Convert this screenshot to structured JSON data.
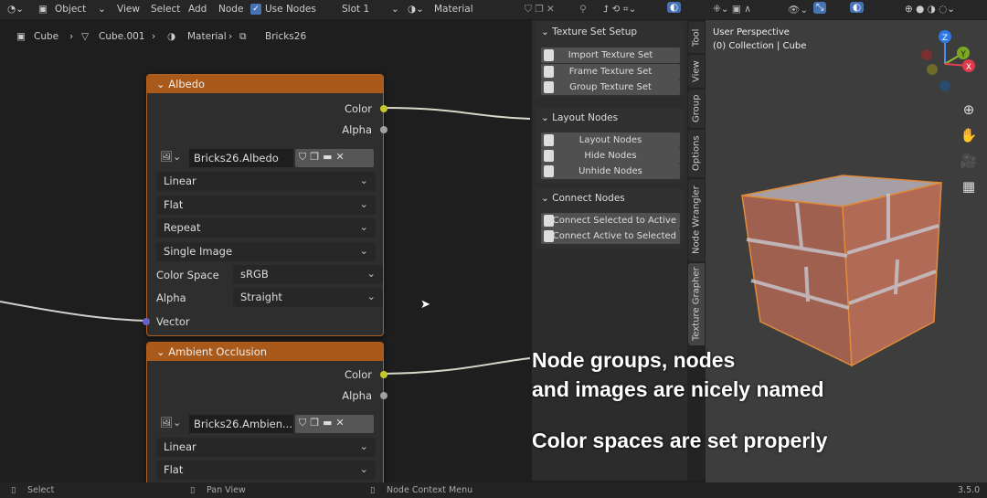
{
  "header": {
    "mode": "Object",
    "menus": [
      "View",
      "Select",
      "Add",
      "Node"
    ],
    "use_nodes_label": "Use Nodes",
    "use_nodes_checked": true,
    "slot": "Slot 1",
    "material": "Material",
    "accent": "#4772b3"
  },
  "breadcrumb": [
    "Cube",
    "Cube.001",
    "Material",
    "Bricks26"
  ],
  "nodes": [
    {
      "title": "Albedo",
      "outputs": [
        "Color",
        "Alpha"
      ],
      "image": "Bricks26.Albedo",
      "interpolation": "Linear",
      "projection": "Flat",
      "extension": "Repeat",
      "source": "Single Image",
      "color_space_label": "Color Space",
      "color_space": "sRGB",
      "alpha_label": "Alpha",
      "alpha": "Straight",
      "input": "Vector"
    },
    {
      "title": "Ambient Occlusion",
      "outputs": [
        "Color",
        "Alpha"
      ],
      "image": "Bricks26.Ambien...",
      "interpolation": "Linear",
      "projection": "Flat"
    }
  ],
  "sidebar": {
    "sections": [
      {
        "title": "Texture Set Setup",
        "buttons": [
          "Import Texture Set",
          "Frame Texture Set",
          "Group Texture Set"
        ]
      },
      {
        "title": "Layout Nodes",
        "buttons": [
          "Layout Nodes",
          "Hide Nodes",
          "Unhide Nodes"
        ]
      },
      {
        "title": "Connect Nodes",
        "buttons": [
          "Connect Selected to Active",
          "Connect Active to Selected"
        ]
      }
    ],
    "tabs": [
      "Tool",
      "View",
      "Group",
      "Options",
      "Node Wrangler",
      "Texture Grapher"
    ]
  },
  "viewport": {
    "title": "User Perspective",
    "subtitle": "(0) Collection | Cube",
    "gizmo": [
      "Z",
      "Y",
      "X"
    ]
  },
  "overlay": {
    "line1": "Node groups, nodes",
    "line2": "and images are nicely named",
    "line3": "Color spaces are set properly"
  },
  "status": {
    "left": "Select",
    "middle": "Pan View",
    "right": "Node Context Menu",
    "version": "3.5.0"
  }
}
